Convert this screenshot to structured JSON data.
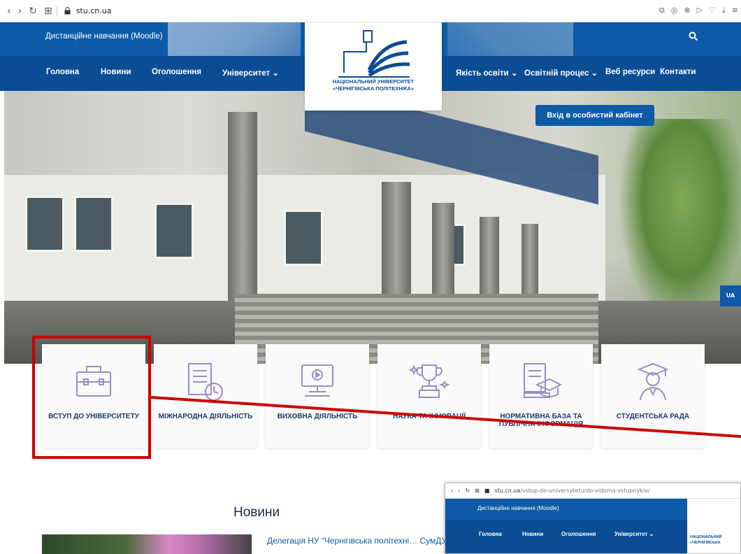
{
  "browser": {
    "back": "‹",
    "forward": "›",
    "reload": "↻",
    "apps": "⊞",
    "url": "stu.cn.ua",
    "tools": [
      "⧉",
      "◎",
      "⊗",
      "▷",
      "♡",
      "⤓",
      "≡"
    ]
  },
  "header": {
    "moodle_link": "Дистанційне навчання (Moodle)",
    "search_icon": "search-icon",
    "logo_line1": "НАЦІОНАЛЬНИЙ УНІВЕРСИТЕТ",
    "logo_line2": "«ЧЕРНІГІВСЬКА ПОЛІТЕХНІКА»"
  },
  "nav": {
    "left": [
      "Головна",
      "Новини",
      "Оголошення",
      "Університет ⌄"
    ],
    "right": [
      "Якість освіти ⌄",
      "Освітній процес ⌄",
      "Веб ресурси",
      "Контакти"
    ]
  },
  "hero": {
    "cabinet_button": "Вхід в особистий кабінет",
    "lang_tab": "UA",
    "slides": 3
  },
  "cards": [
    {
      "label": "ВСТУП ДО УНІВЕРСИТЕТУ",
      "icon": "briefcase-icon"
    },
    {
      "label": "МІЖНАРОДНА ДІЯЛЬНІСТЬ",
      "icon": "document-clock-icon"
    },
    {
      "label": "ВИХОВНА ДІЯЛЬНІСТЬ",
      "icon": "computer-video-icon"
    },
    {
      "label": "НАУКА ТА ІННОВАЦІЇ",
      "icon": "trophy-icon"
    },
    {
      "label": "НОРМАТИВНА БАЗА ТА ПУБЛІЧНА ІНФОРМАЦІЯ",
      "icon": "book-graduation-icon"
    },
    {
      "label": "СТУДЕНТСЬКА РАДА",
      "icon": "graduate-student-icon"
    }
  ],
  "news": {
    "heading": "Новини",
    "first_item": "Делегація НУ “Чернігівська політехні… СумДУ"
  },
  "inset": {
    "url_host": "stu.cn.ua",
    "url_path": "/vstup-do-universytetu/do-vidoma-vstupnykiv/",
    "moodle_link": "Дистанційне навчання (Moodle)",
    "nav": [
      "Головна",
      "Новини",
      "Оголошення",
      "Університет ⌄"
    ],
    "logo_line1": "НАЦІОНАЛЬНИЙ",
    "logo_line2": "«ЧЕРНІГІВСЬКА"
  },
  "colors": {
    "primary": "#0d5aa7",
    "nav": "#0a4d94",
    "highlight": "#cc0000"
  }
}
